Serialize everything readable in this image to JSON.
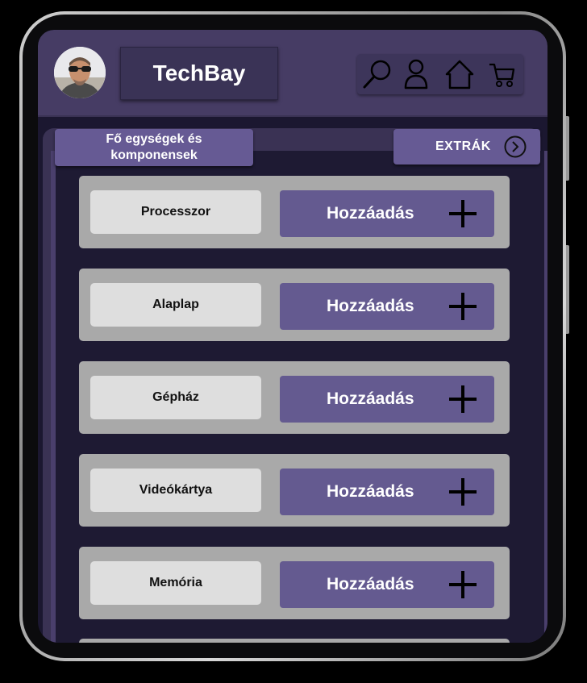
{
  "header": {
    "brand": "TechBay",
    "icons": [
      "search-icon",
      "user-icon",
      "home-icon",
      "cart-icon"
    ]
  },
  "tabs": {
    "main_label": "Fő egységek és komponensek",
    "extra_label": "EXTRÁK"
  },
  "components": [
    {
      "name": "Processzor",
      "action": "Hozzáadás"
    },
    {
      "name": "Alaplap",
      "action": "Hozzáadás"
    },
    {
      "name": "Gépház",
      "action": "Hozzáadás"
    },
    {
      "name": "Videókártya",
      "action": "Hozzáadás"
    },
    {
      "name": "Memória",
      "action": "Hozzáadás"
    }
  ],
  "colors": {
    "header": "#463c64",
    "accent": "#645a90",
    "row": "#a9a9a9",
    "background": "#1e1a33"
  }
}
